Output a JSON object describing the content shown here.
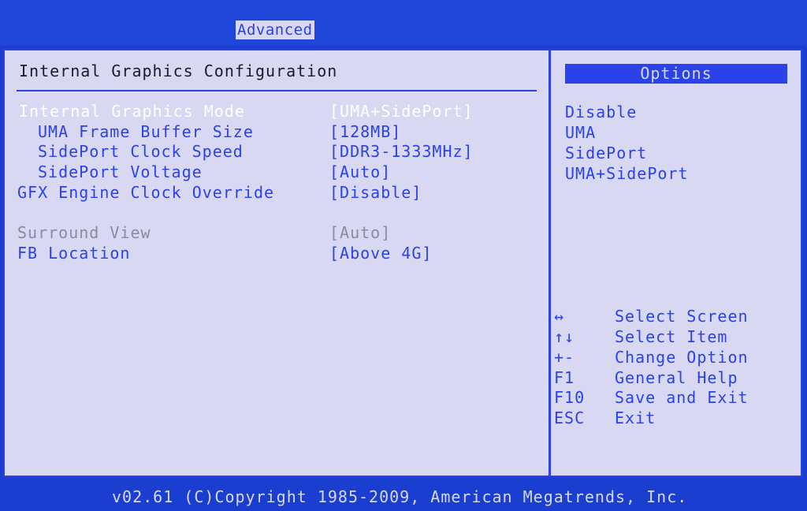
{
  "header": {
    "active_tab": "Advanced"
  },
  "main": {
    "section_title": "Internal Graphics Configuration",
    "settings": [
      {
        "label": "Internal Graphics Mode",
        "value": "[UMA+SidePort]",
        "state": "selected",
        "indent": false
      },
      {
        "label": "UMA Frame Buffer Size",
        "value": "[128MB]",
        "state": "normal",
        "indent": true
      },
      {
        "label": "SidePort Clock Speed",
        "value": "[DDR3-1333MHz]",
        "state": "normal",
        "indent": true
      },
      {
        "label": "SidePort Voltage",
        "value": "[Auto]",
        "state": "normal",
        "indent": true
      },
      {
        "label": "GFX Engine Clock Override",
        "value": "[Disable]",
        "state": "normal",
        "indent": false
      },
      {
        "label": "Surround View",
        "value": "[Auto]",
        "state": "disabled",
        "indent": false
      },
      {
        "label": "FB Location",
        "value": "[Above 4G]",
        "state": "normal",
        "indent": false
      }
    ]
  },
  "options_panel": {
    "title": "Options",
    "items": [
      "Disable",
      "UMA",
      "SidePort",
      "UMA+SidePort"
    ]
  },
  "help": [
    {
      "key": "↔",
      "action": "Select Screen"
    },
    {
      "key": "↑↓",
      "action": "Select Item"
    },
    {
      "key": "+-",
      "action": "Change Option"
    },
    {
      "key": "F1",
      "action": "General Help"
    },
    {
      "key": "F10",
      "action": "Save and Exit"
    },
    {
      "key": "ESC",
      "action": "Exit"
    }
  ],
  "footer": {
    "text": "v02.61 (C)Copyright 1985-2009, American Megatrends, Inc."
  },
  "colors": {
    "background_blue": "#1a3fd0",
    "panel_gray": "#d8d8f2",
    "accent_blue": "#2a42e8",
    "selected_text": "#ffffff",
    "disabled_text": "#8a8aa4"
  }
}
